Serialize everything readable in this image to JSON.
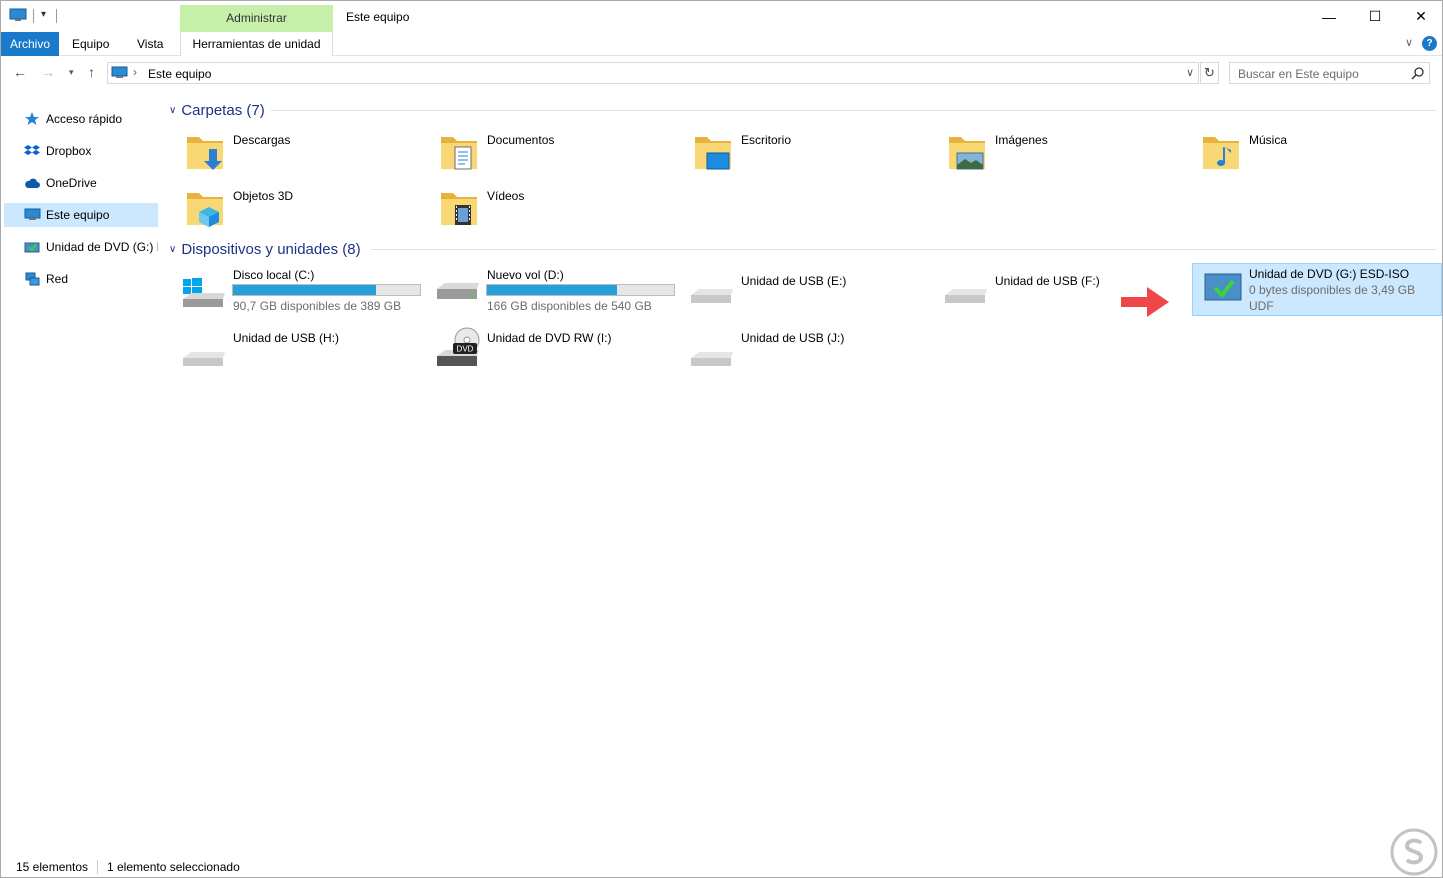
{
  "titlebar": {
    "context_tab": "Administrar",
    "title": "Este equipo",
    "minimize": "—",
    "maximize": "☐",
    "close": "✕"
  },
  "ribbon": {
    "tabs": [
      "Archivo",
      "Equipo",
      "Vista",
      "Herramientas de unidad"
    ],
    "toggle": "∨",
    "help": "?"
  },
  "address": {
    "path": "Este equipo",
    "refresh": "↻",
    "search_placeholder": "Buscar en Este equipo"
  },
  "sidebar": {
    "items": [
      {
        "label": "Acceso rápido",
        "icon": "star-icon"
      },
      {
        "label": "Dropbox",
        "icon": "dropbox-icon"
      },
      {
        "label": "OneDrive",
        "icon": "cloud-icon"
      },
      {
        "label": "Este equipo",
        "icon": "computer-icon",
        "selected": true
      },
      {
        "label": "Unidad de DVD (G:) E",
        "icon": "dvd-iso-icon"
      },
      {
        "label": "Red",
        "icon": "network-icon"
      }
    ]
  },
  "groups": {
    "folders": {
      "title": "Carpetas (7)"
    },
    "devices": {
      "title": "Dispositivos y unidades (8)"
    }
  },
  "folders": [
    {
      "label": "Descargas",
      "icon": "downloads-folder-icon"
    },
    {
      "label": "Documentos",
      "icon": "documents-folder-icon"
    },
    {
      "label": "Escritorio",
      "icon": "desktop-folder-icon"
    },
    {
      "label": "Imágenes",
      "icon": "pictures-folder-icon"
    },
    {
      "label": "Música",
      "icon": "music-folder-icon"
    },
    {
      "label": "Objetos 3D",
      "icon": "3d-objects-folder-icon"
    },
    {
      "label": "Vídeos",
      "icon": "videos-folder-icon"
    }
  ],
  "drives": [
    {
      "label": "Disco local (C:)",
      "sub": "90,7 GB disponibles de 389 GB",
      "used_fraction": 0.767,
      "icon": "windows-drive-icon"
    },
    {
      "label": "Nuevo vol (D:)",
      "sub": "166 GB disponibles de 540 GB",
      "used_fraction": 0.693,
      "icon": "hard-drive-icon"
    },
    {
      "label": "Unidad de USB (E:)",
      "icon": "usb-drive-icon"
    },
    {
      "label": "Unidad de USB (F:)",
      "icon": "usb-drive-icon"
    },
    {
      "label": "Unidad de DVD (G:) ESD-ISO",
      "sub": "0 bytes disponibles de 3,49 GB",
      "sub2": "UDF",
      "icon": "dvd-iso-icon",
      "selected": true
    },
    {
      "label": "Unidad de USB (H:)",
      "icon": "usb-drive-icon"
    },
    {
      "label": "Unidad de DVD RW (I:)",
      "icon": "dvd-rw-drive-icon",
      "badge": "DVD"
    },
    {
      "label": "Unidad de USB (J:)",
      "icon": "usb-drive-icon"
    }
  ],
  "status": {
    "count": "15 elementos",
    "selection": "1 elemento seleccionado"
  },
  "colors": {
    "accent": "#1979ca",
    "selection": "#cce8ff",
    "context_tab": "#c6efaa",
    "header_text": "#1e3287",
    "bar_fill": "#26a0da",
    "arrow": "#f0464a"
  }
}
